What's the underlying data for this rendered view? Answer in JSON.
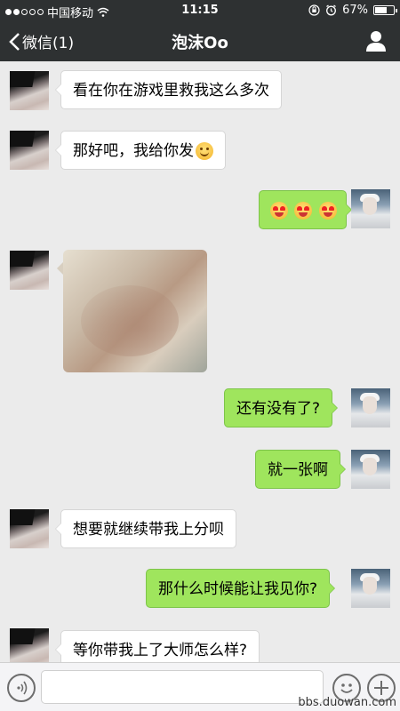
{
  "status_bar": {
    "carrier": "中国移动",
    "time": "11:15",
    "battery": "67%",
    "battery_level": 0.67
  },
  "nav": {
    "back_label": "微信(1)",
    "title": "泡沫Oo"
  },
  "messages": [
    {
      "from": "her",
      "text": "看在你在游戏里救我这么多次"
    },
    {
      "from": "her",
      "text": "那好吧，我给你发",
      "emoji": "smile"
    },
    {
      "from": "me",
      "emoji": [
        "heart-eyes",
        "heart-eyes",
        "heart-eyes"
      ]
    },
    {
      "from": "her",
      "type": "image"
    },
    {
      "from": "me",
      "text": "还有没有了?"
    },
    {
      "from": "me",
      "text": "就一张啊"
    },
    {
      "from": "her",
      "text": "想要就继续带我上分呗"
    },
    {
      "from": "me",
      "text": "那什么时候能让我见你?"
    },
    {
      "from": "her",
      "text": "等你带我上了大师怎么样?"
    }
  ],
  "input": {
    "value": "",
    "placeholder": ""
  },
  "watermark": "bbs.duowan.com"
}
